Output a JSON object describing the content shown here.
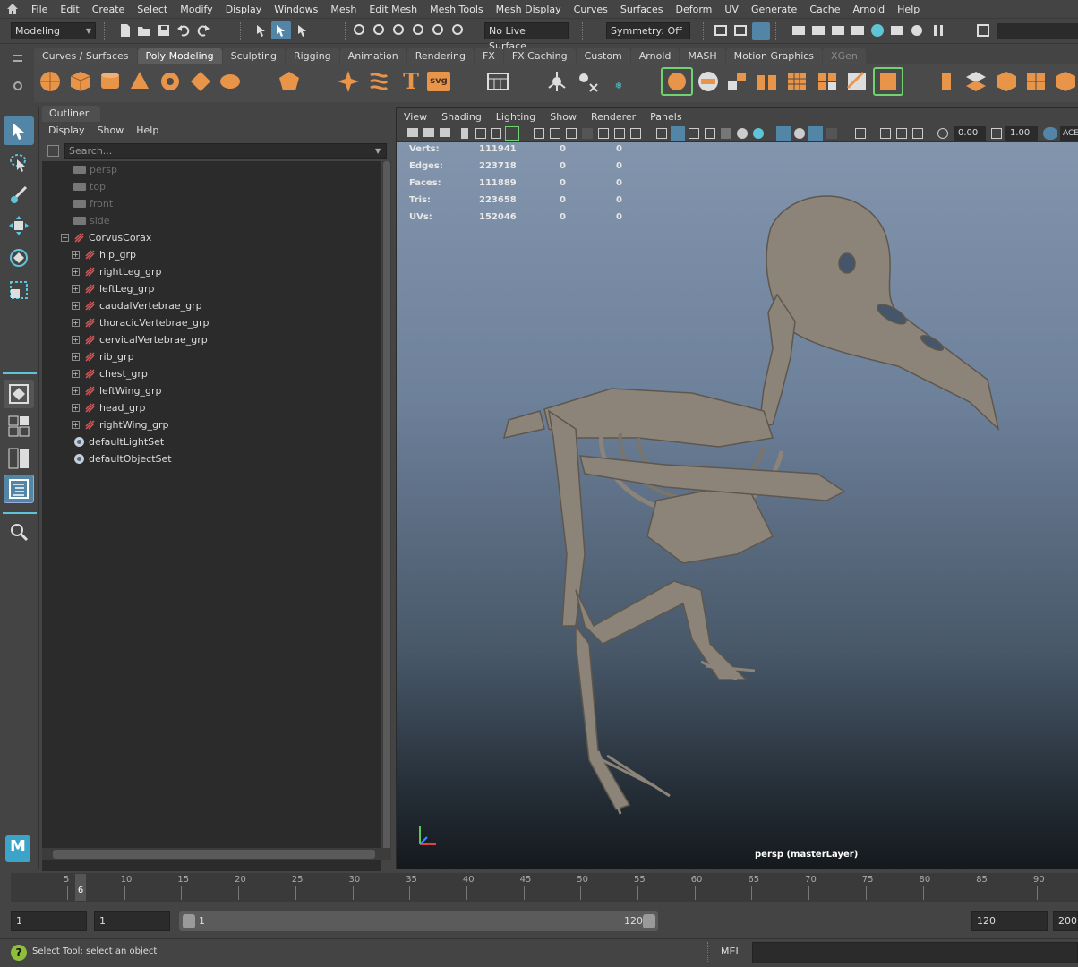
{
  "menu": {
    "items": [
      "File",
      "Edit",
      "Create",
      "Select",
      "Modify",
      "Display",
      "Windows",
      "Mesh",
      "Edit Mesh",
      "Mesh Tools",
      "Mesh Display",
      "Curves",
      "Surfaces",
      "Deform",
      "UV",
      "Generate",
      "Cache",
      "Arnold",
      "Help"
    ]
  },
  "statusline": {
    "mode": "Modeling",
    "live_surface": "No Live Surface",
    "symmetry": "Symmetry: Off"
  },
  "shelf": {
    "tabs": [
      "Curves / Surfaces",
      "Poly Modeling",
      "Sculpting",
      "Rigging",
      "Animation",
      "Rendering",
      "FX",
      "FX Caching",
      "Custom",
      "Arnold",
      "MASH",
      "Motion Graphics",
      "XGen"
    ],
    "active_tab": "Poly Modeling",
    "accent_color": "#e8954a"
  },
  "outliner": {
    "title": "Outliner",
    "menu": [
      "Display",
      "Show",
      "Help"
    ],
    "search_placeholder": "Search...",
    "cameras": [
      "persp",
      "top",
      "front",
      "side"
    ],
    "root": "CorvusCorax",
    "groups": [
      "hip_grp",
      "rightLeg_grp",
      "leftLeg_grp",
      "caudalVertebrae_grp",
      "thoracicVertebrae_grp",
      "cervicalVertebrae_grp",
      "rib_grp",
      "chest_grp",
      "leftWing_grp",
      "head_grp",
      "rightWing_grp"
    ],
    "sets": [
      "defaultLightSet",
      "defaultObjectSet"
    ]
  },
  "viewport": {
    "menu": [
      "View",
      "Shading",
      "Lighting",
      "Show",
      "Renderer",
      "Panels"
    ],
    "field_value_1": "0.00",
    "field_value_2": "1.00",
    "field_label_3": "ACE",
    "camera_label": "persp (masterLayer)",
    "hud": [
      {
        "label": "Verts:",
        "v1": "111941",
        "v2": "0",
        "v3": "0"
      },
      {
        "label": "Edges:",
        "v1": "223718",
        "v2": "0",
        "v3": "0"
      },
      {
        "label": "Faces:",
        "v1": "111889",
        "v2": "0",
        "v3": "0"
      },
      {
        "label": "Tris:",
        "v1": "223658",
        "v2": "0",
        "v3": "0"
      },
      {
        "label": "UVs:",
        "v1": "152046",
        "v2": "0",
        "v3": "0"
      }
    ]
  },
  "timeline": {
    "ticks": [
      "5",
      "10",
      "15",
      "20",
      "25",
      "30",
      "35",
      "40",
      "45",
      "50",
      "55",
      "60",
      "65",
      "70",
      "75",
      "80",
      "85",
      "90"
    ],
    "current_frame": "6"
  },
  "range": {
    "start": "1",
    "playback_start": "1",
    "slider_start": "1",
    "slider_end": "120",
    "playback_end": "120",
    "end": "200"
  },
  "helpline": {
    "text": "Select Tool: select an object",
    "mel": "MEL"
  },
  "logo_text": "M"
}
